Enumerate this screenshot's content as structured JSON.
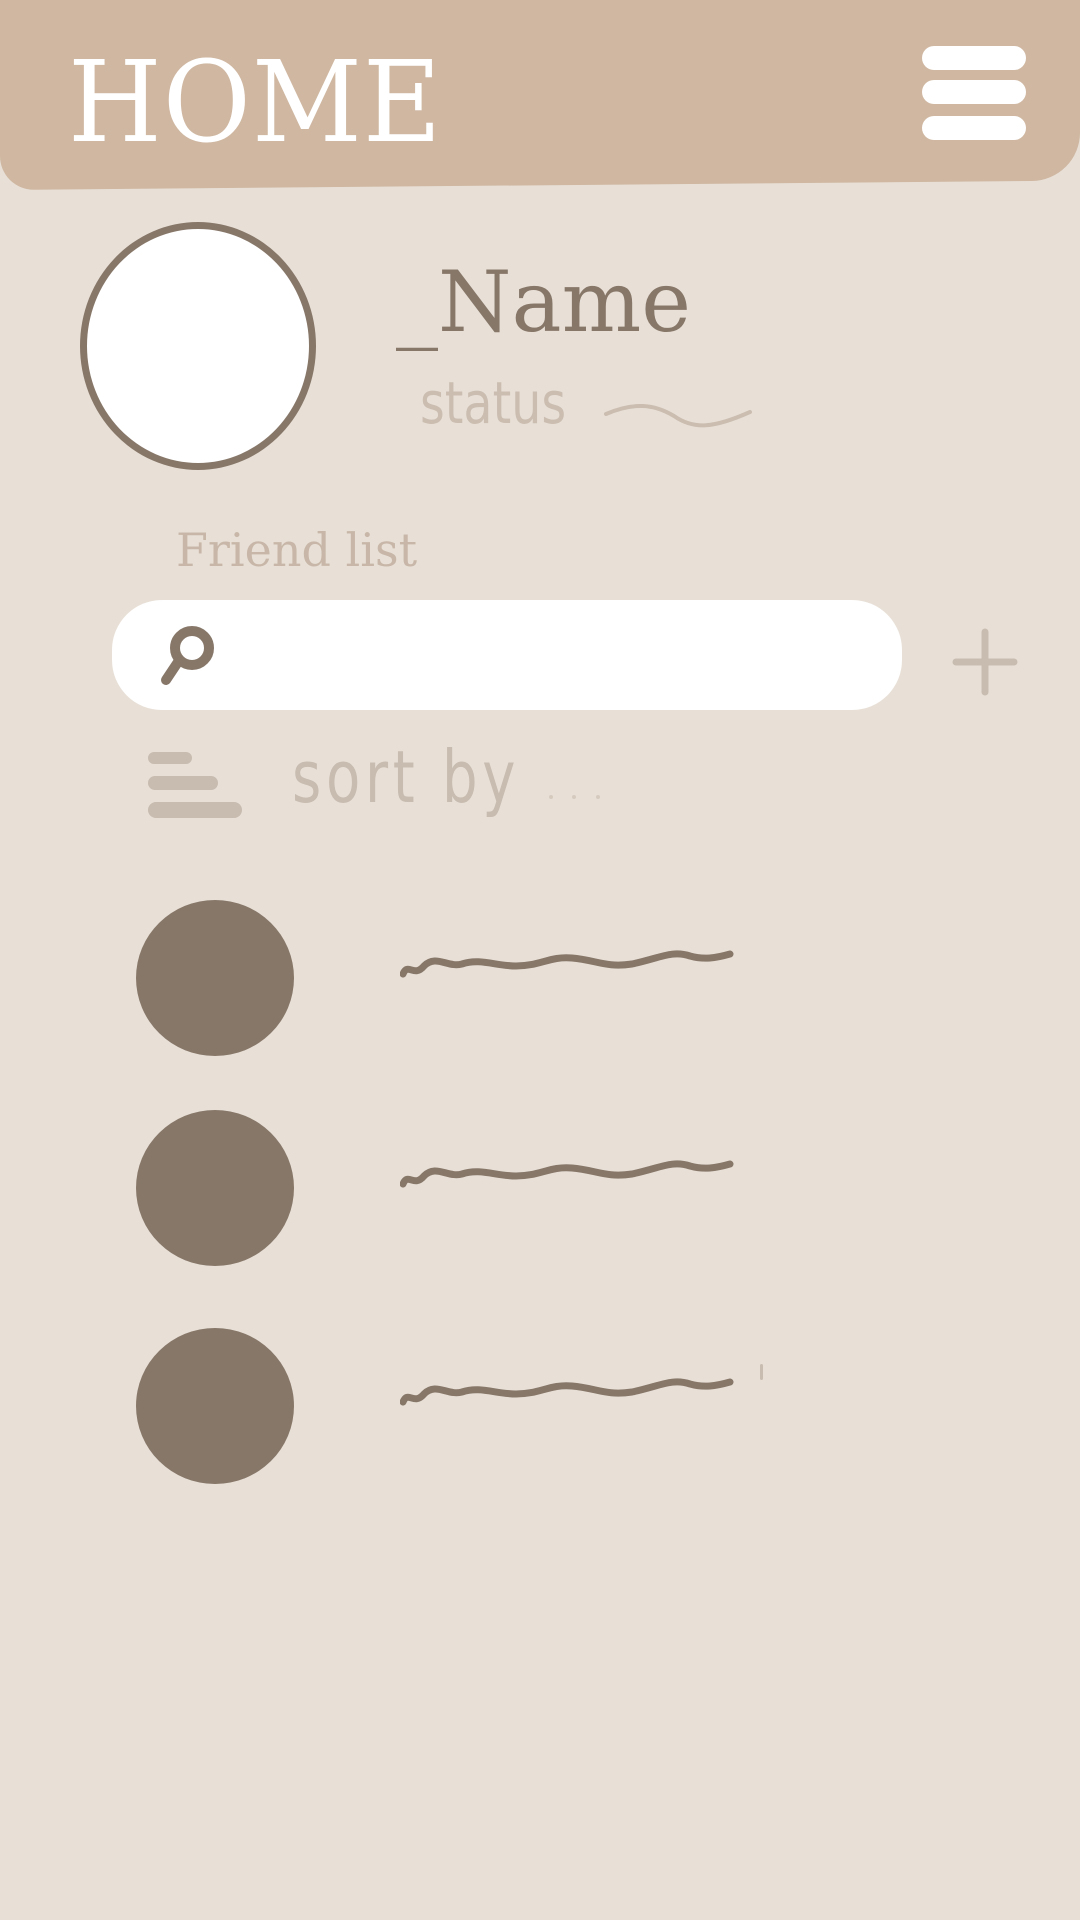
{
  "header": {
    "title": "HOME",
    "menu_icon": "hamburger-menu-icon",
    "background_color": "#cfb7a1"
  },
  "profile": {
    "name": "_Name",
    "status": "status"
  },
  "friends": {
    "section_label": "Friend list",
    "search": {
      "icon": "search-icon",
      "value": ""
    },
    "add_icon": "plus-icon",
    "sort": {
      "icon": "sort-icon",
      "label": "sort by"
    },
    "items": [
      {
        "avatar_icon": "avatar-icon"
      },
      {
        "avatar_icon": "avatar-icon"
      },
      {
        "avatar_icon": "avatar-icon"
      }
    ]
  },
  "colors": {
    "background": "#e8e0d7",
    "accent_dark": "#877769",
    "muted_text": "#c8bbaf",
    "white": "#ffffff"
  }
}
